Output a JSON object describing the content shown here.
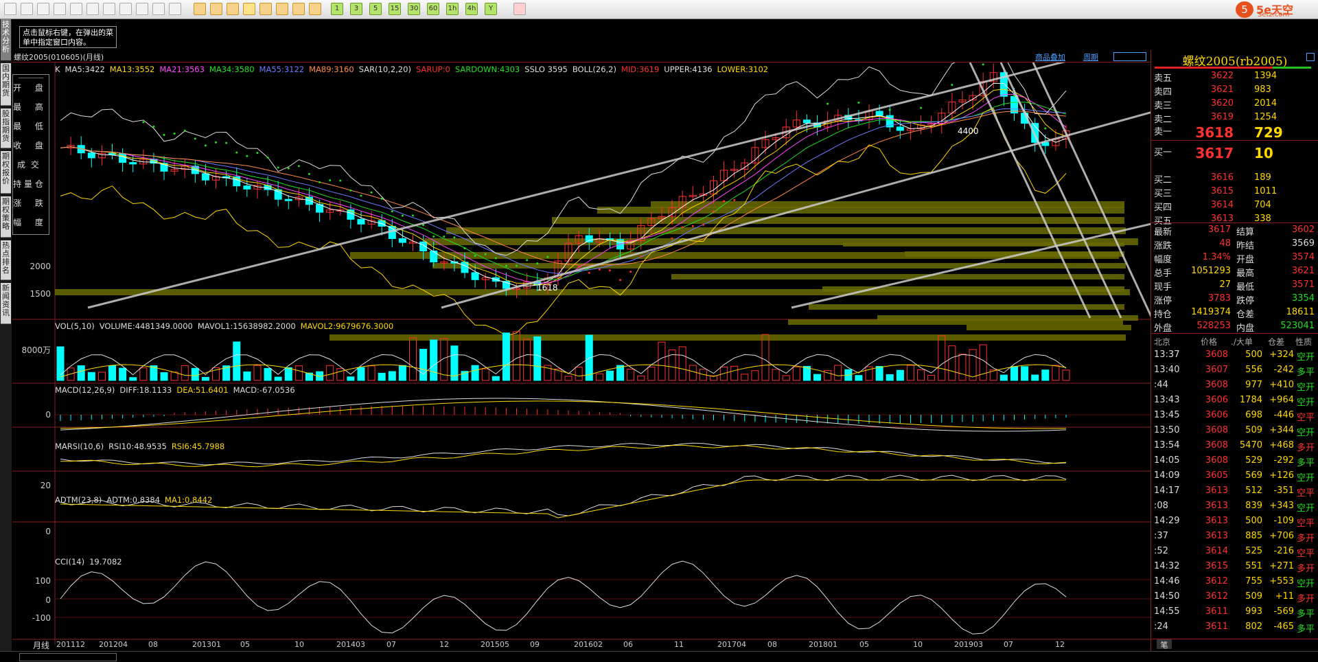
{
  "colors": {
    "up": "#ff3030",
    "down": "#00ffff",
    "accent": "#ffd800",
    "green": "#20e020",
    "grid": "#8a1f1f"
  },
  "toolbar": {
    "icons": [
      "home-icon",
      "save-icon",
      "open-icon",
      "refresh-icon",
      "search-icon",
      "find-icon",
      "window-icon",
      "draw-icon",
      "pen-icon",
      "filter-icon",
      "news-icon",
      "table-icon",
      "chart-icon",
      "fenbi-icon",
      "day-icon",
      "week-icon",
      "month-icon",
      "quarter-icon",
      "year-icon"
    ],
    "periods": [
      "1",
      "3",
      "5",
      "15",
      "30",
      "60",
      "1h",
      "4h",
      "Y"
    ],
    "calendar_icon": "calendar-icon",
    "logo_text": "5e天空",
    "logo_url": "Setz.com"
  },
  "sidebar": {
    "tabs": [
      "技术分析",
      "国内期货",
      "股指期货",
      "期权报价",
      "期权策略",
      "热点排名",
      "新闻资讯"
    ]
  },
  "tip": "点击鼠标右键，在弹出的菜单中指定窗口内容。",
  "title": {
    "symbol": "螺纹2005(010605)(月线)",
    "links": [
      "商品叠加",
      "周期"
    ]
  },
  "main_indicators": [
    {
      "text": "K",
      "color": "#dddddd"
    },
    {
      "text": "MA5:3422",
      "color": "#dddddd"
    },
    {
      "text": "MA13:3552",
      "color": "#ffd800"
    },
    {
      "text": "MA21:3563",
      "color": "#ff44ff"
    },
    {
      "text": "MA34:3580",
      "color": "#20e020"
    },
    {
      "text": "MA55:3122",
      "color": "#6a7aff"
    },
    {
      "text": "MA89:3160",
      "color": "#ff8844"
    },
    {
      "text": "SAR(10,2,20)",
      "color": "#dddddd"
    },
    {
      "text": "SARUP:0",
      "color": "#ff3030"
    },
    {
      "text": "SARDOWN:4303",
      "color": "#20e020"
    },
    {
      "text": "SSLO 3595",
      "color": "#dddddd"
    },
    {
      "text": "BOLL(26,2)",
      "color": "#dddddd"
    },
    {
      "text": "MID:3619",
      "color": "#ff3030"
    },
    {
      "text": "UPPER:4136",
      "color": "#dddddd"
    },
    {
      "text": "LOWER:3102",
      "color": "#ffd800"
    }
  ],
  "data_window": [
    "开 盘",
    "最 高",
    "最 低",
    "收 盘",
    "成交量",
    "持 仓",
    "涨 跌",
    "幅 度"
  ],
  "main_axis": [
    "2000",
    "1500"
  ],
  "axis_hint": "2500",
  "annotations": {
    "high": "4400",
    "low": "1618"
  },
  "vol": {
    "label": [
      {
        "text": "VOL(5,10)",
        "color": "#dddddd"
      },
      {
        "text": "VOLUME:4481349.0000",
        "color": "#dddddd"
      },
      {
        "text": "MAVOL1:15638982.2000",
        "color": "#dddddd"
      },
      {
        "text": "MAVOL2:9679676.3000",
        "color": "#ffd800"
      }
    ],
    "axis": "8000万"
  },
  "macd": {
    "label": [
      {
        "text": "MACD(12,26,9)",
        "color": "#dddddd"
      },
      {
        "text": "DIFF:18.1133",
        "color": "#dddddd"
      },
      {
        "text": "DEA:51.6401",
        "color": "#ffd800"
      },
      {
        "text": "MACD:-67.0536",
        "color": "#dddddd"
      }
    ],
    "axis": "0"
  },
  "marsi": {
    "label": [
      {
        "text": "MARSI(10,6)",
        "color": "#dddddd"
      },
      {
        "text": "RSI10:48.9535",
        "color": "#dddddd"
      },
      {
        "text": "RSI6:45.7988",
        "color": "#ffd800"
      }
    ],
    "axis": "20"
  },
  "adtm": {
    "label": [
      {
        "text": "ADTM(23,8)",
        "color": "#dddddd"
      },
      {
        "text": "ADTM:0.8384",
        "color": "#dddddd"
      },
      {
        "text": "MA1:0.8442",
        "color": "#ffd800"
      }
    ],
    "axis": "0"
  },
  "cci": {
    "label": [
      {
        "text": "CCI(14)",
        "color": "#dddddd"
      },
      {
        "text": "19.7082",
        "color": "#dddddd"
      }
    ],
    "axis": [
      "100",
      "0",
      "-100"
    ]
  },
  "xaxis": {
    "period_label": "月线",
    "labels": [
      "201112",
      "201204",
      "08",
      "201301",
      "05",
      "10",
      "201403",
      "07",
      "12",
      "201505",
      "09",
      "201602",
      "06",
      "11",
      "201704",
      "08",
      "201801",
      "05",
      "10",
      "201903",
      "07",
      "12"
    ]
  },
  "quote": {
    "name": "螺纹2005(rb2005)",
    "asks": [
      {
        "l": "卖五",
        "p": "3622",
        "v": "1394"
      },
      {
        "l": "卖四",
        "p": "3621",
        "v": "983"
      },
      {
        "l": "卖三",
        "p": "3620",
        "v": "2014"
      },
      {
        "l": "卖二",
        "p": "3619",
        "v": "1254"
      },
      {
        "l": "卖一",
        "p": "3618",
        "v": "729"
      }
    ],
    "bids": [
      {
        "l": "买一",
        "p": "3617",
        "v": "10"
      },
      {
        "l": "买二",
        "p": "3616",
        "v": "189"
      },
      {
        "l": "买三",
        "p": "3615",
        "v": "1011"
      },
      {
        "l": "买四",
        "p": "3614",
        "v": "704"
      },
      {
        "l": "买五",
        "p": "3613",
        "v": "338"
      }
    ],
    "stats": [
      {
        "k1": "最新",
        "v1": "3617",
        "c1": "#ff3030",
        "k2": "结算",
        "v2": "3602",
        "c2": "#ff3030"
      },
      {
        "k1": "涨跌",
        "v1": "48",
        "c1": "#ff3030",
        "k2": "昨结",
        "v2": "3569",
        "c2": "#dddddd"
      },
      {
        "k1": "幅度",
        "v1": "1.34%",
        "c1": "#ff3030",
        "k2": "开盘",
        "v2": "3574",
        "c2": "#ff3030"
      },
      {
        "k1": "总手",
        "v1": "1051293",
        "c1": "#ffd800",
        "k2": "最高",
        "v2": "3621",
        "c2": "#ff3030"
      },
      {
        "k1": "现手",
        "v1": "27",
        "c1": "#ffd800",
        "k2": "最低",
        "v2": "3571",
        "c2": "#ff3030"
      },
      {
        "k1": "涨停",
        "v1": "3783",
        "c1": "#ff3030",
        "k2": "跌停",
        "v2": "3354",
        "c2": "#20e020"
      },
      {
        "k1": "持仓",
        "v1": "1419374",
        "c1": "#ffd800",
        "k2": "仓差",
        "v2": "18611",
        "c2": "#ffd800"
      },
      {
        "k1": "外盘",
        "v1": "528253",
        "c1": "#ff3030",
        "k2": "内盘",
        "v2": "523041",
        "c2": "#20e020"
      }
    ],
    "tick_header": [
      "北京",
      "价格",
      "./大单",
      "仓差",
      "性质"
    ],
    "ticks": [
      {
        "t": "13:37",
        "p": "3608",
        "v": "500",
        "d": "+324",
        "n": "空开",
        "dc": "#ffd800",
        "nc": "#20e020"
      },
      {
        "t": "13:40",
        "p": "3607",
        "v": "556",
        "d": "-242",
        "n": "多平",
        "dc": "#ffd800",
        "nc": "#20e020"
      },
      {
        "t": ":44",
        "p": "3608",
        "v": "977",
        "d": "+410",
        "n": "空开",
        "dc": "#ffd800",
        "nc": "#20e020"
      },
      {
        "t": "13:43",
        "p": "3606",
        "v": "1784",
        "d": "+964",
        "n": "空开",
        "dc": "#ffd800",
        "nc": "#20e020"
      },
      {
        "t": "13:45",
        "p": "3606",
        "v": "698",
        "d": "-446",
        "n": "空平",
        "dc": "#ffd800",
        "nc": "#ff3030"
      },
      {
        "t": "13:50",
        "p": "3608",
        "v": "509",
        "d": "+344",
        "n": "空开",
        "dc": "#ffd800",
        "nc": "#20e020"
      },
      {
        "t": "13:54",
        "p": "3608",
        "v": "5470",
        "d": "+468",
        "n": "多开",
        "dc": "#ffd800",
        "nc": "#ff3030"
      },
      {
        "t": "14:05",
        "p": "3608",
        "v": "529",
        "d": "-292",
        "n": "多平",
        "dc": "#ffd800",
        "nc": "#20e020"
      },
      {
        "t": "14:09",
        "p": "3605",
        "v": "569",
        "d": "+126",
        "n": "空开",
        "dc": "#ffd800",
        "nc": "#20e020"
      },
      {
        "t": "14:17",
        "p": "3613",
        "v": "512",
        "d": "-351",
        "n": "空平",
        "dc": "#ffd800",
        "nc": "#ff3030"
      },
      {
        "t": ":08",
        "p": "3613",
        "v": "839",
        "d": "+343",
        "n": "空开",
        "dc": "#ffd800",
        "nc": "#20e020"
      },
      {
        "t": "14:29",
        "p": "3613",
        "v": "500",
        "d": "-109",
        "n": "空平",
        "dc": "#ffd800",
        "nc": "#ff3030"
      },
      {
        "t": ":37",
        "p": "3613",
        "v": "885",
        "d": "+706",
        "n": "多开",
        "dc": "#ffd800",
        "nc": "#ff3030"
      },
      {
        "t": ":52",
        "p": "3614",
        "v": "525",
        "d": "-216",
        "n": "空平",
        "dc": "#ffd800",
        "nc": "#ff3030"
      },
      {
        "t": "14:32",
        "p": "3615",
        "v": "551",
        "d": "+271",
        "n": "多开",
        "dc": "#ffd800",
        "nc": "#ff3030"
      },
      {
        "t": "14:46",
        "p": "3612",
        "v": "755",
        "d": "+553",
        "n": "空开",
        "dc": "#ffd800",
        "nc": "#20e020"
      },
      {
        "t": "14:50",
        "p": "3612",
        "v": "509",
        "d": "+11",
        "n": "多开",
        "dc": "#ffd800",
        "nc": "#ff3030"
      },
      {
        "t": "14:55",
        "p": "3611",
        "v": "993",
        "d": "-569",
        "n": "多平",
        "dc": "#ffd800",
        "nc": "#20e020"
      },
      {
        "t": ":24",
        "p": "3611",
        "v": "802",
        "d": "-465",
        "n": "多平",
        "dc": "#ffd800",
        "nc": "#20e020"
      }
    ],
    "footer_tab": "笔"
  }
}
